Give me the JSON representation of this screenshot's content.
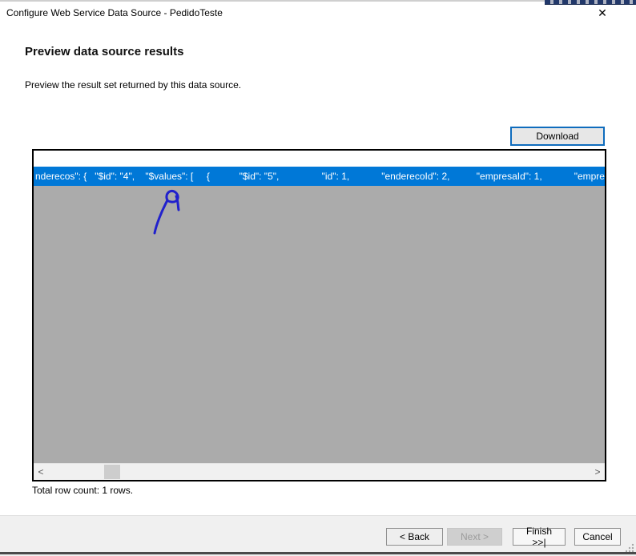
{
  "window": {
    "title": "Configure Web Service Data Source - PedidoTeste",
    "close_icon": "✕"
  },
  "header": {
    "title": "Preview data source results",
    "subtitle": "Preview the result set returned by this data source."
  },
  "toolbar": {
    "download_label": "Download"
  },
  "grid": {
    "selected_row_text": "nderecos\": {   \"$id\": \"4\",    \"$values\": [     {           \"$id\": \"5\",                \"id\": 1,            \"enderecoId\": 2,          \"empresaId\": 1,            \"empresa",
    "scrollbar": {
      "left_arrow": "<",
      "right_arrow": ">"
    }
  },
  "status": {
    "total_row_count": "Total row count: 1 rows."
  },
  "footer": {
    "back_label": "< Back",
    "next_label": "Next >",
    "finish_label": "Finish >>|",
    "cancel_label": "Cancel"
  },
  "annotation": {
    "description": "hand-drawn blue ink arrow pointing up at the selected row"
  },
  "colors": {
    "selection_blue": "#0078d7",
    "grid_body_gray": "#ababab",
    "download_border_blue": "#0f6cbd",
    "annotation_ink": "#2121cc",
    "footer_gray": "#f0f0f0"
  }
}
